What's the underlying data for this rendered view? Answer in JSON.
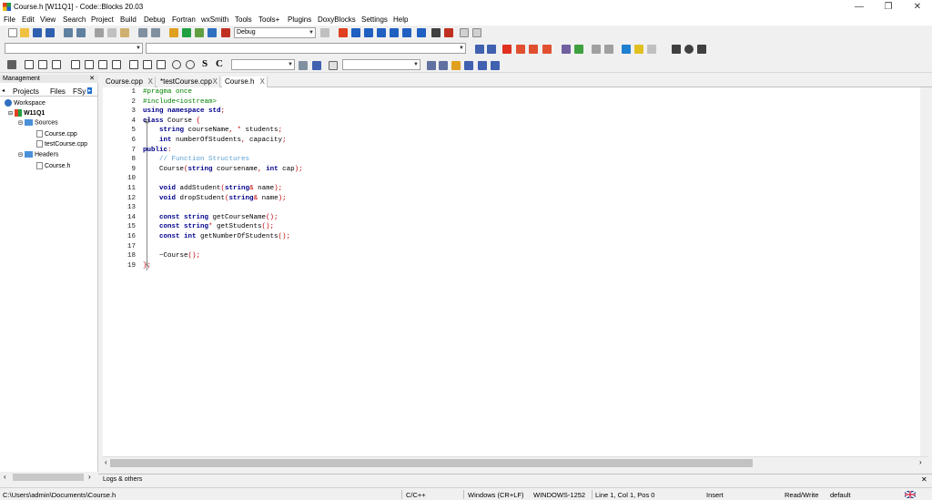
{
  "window": {
    "title": "Course.h [W11Q1] - Code::Blocks 20.03",
    "minimize_glyph": "—",
    "maximize_glyph": "❐",
    "close_glyph": "✕"
  },
  "menu": [
    "File",
    "Edit",
    "View",
    "Search",
    "Project",
    "Build",
    "Debug",
    "Fortran",
    "wxSmith",
    "Tools",
    "Tools+",
    "Plugins",
    "DoxyBlocks",
    "Settings",
    "Help"
  ],
  "toolbar": {
    "build_target": "Debug",
    "symbol_search": "S",
    "case_label": "C"
  },
  "management": {
    "header": "Management",
    "tabs": [
      "Projects",
      "Files",
      "FSy"
    ],
    "tree": {
      "workspace": "Workspace",
      "project": "W11Q1",
      "sources": "Sources",
      "source_files": [
        "Course.cpp",
        "testCourse.cpp"
      ],
      "headers": "Headers",
      "header_files": [
        "Course.h"
      ]
    }
  },
  "editor": {
    "tabs": [
      {
        "label": "Course.cpp",
        "active": false
      },
      {
        "label": "*testCourse.cpp",
        "active": false
      },
      {
        "label": "Course.h",
        "active": true
      }
    ],
    "tab_close_glyph": "X",
    "lines": [
      [
        {
          "t": "#pragma once",
          "c": "pp"
        }
      ],
      [
        {
          "t": "#include<iostream>",
          "c": "pp"
        }
      ],
      [
        {
          "t": "using namespace std",
          "c": "kw"
        },
        {
          "t": ";",
          "c": "op"
        }
      ],
      [
        {
          "t": "class",
          "c": "kw"
        },
        {
          "t": " Course ",
          "c": ""
        },
        {
          "t": "{",
          "c": "op"
        }
      ],
      [
        {
          "t": "    string",
          "c": "kw"
        },
        {
          "t": " courseName",
          "": ""
        },
        {
          "t": ", * ",
          "c": "op"
        },
        {
          "t": "students",
          "c": ""
        },
        {
          "t": ";",
          "c": "op"
        }
      ],
      [
        {
          "t": "    int",
          "c": "kw"
        },
        {
          "t": " numberOfStudents",
          "c": ""
        },
        {
          "t": ", ",
          "c": "op"
        },
        {
          "t": "capacity",
          "c": ""
        },
        {
          "t": ";",
          "c": "op"
        }
      ],
      [
        {
          "t": "public",
          "c": "kw"
        },
        {
          "t": ":",
          "c": "op"
        }
      ],
      [
        {
          "t": "    // Function Structures",
          "c": "cm"
        }
      ],
      [
        {
          "t": "    Course",
          "c": ""
        },
        {
          "t": "(",
          "c": "op"
        },
        {
          "t": "string",
          "c": "kw"
        },
        {
          "t": " coursename",
          "c": ""
        },
        {
          "t": ", ",
          "c": "op"
        },
        {
          "t": "int",
          "c": "kw"
        },
        {
          "t": " cap",
          "c": ""
        },
        {
          "t": ");",
          "c": "op"
        }
      ],
      [],
      [
        {
          "t": "    void",
          "c": "kw"
        },
        {
          "t": " addStudent",
          "c": ""
        },
        {
          "t": "(",
          "c": "op"
        },
        {
          "t": "string",
          "c": "kw"
        },
        {
          "t": "& ",
          "c": "op"
        },
        {
          "t": "name",
          "c": ""
        },
        {
          "t": ");",
          "c": "op"
        }
      ],
      [
        {
          "t": "    void",
          "c": "kw"
        },
        {
          "t": " dropStudent",
          "c": ""
        },
        {
          "t": "(",
          "c": "op"
        },
        {
          "t": "string",
          "c": "kw"
        },
        {
          "t": "& ",
          "c": "op"
        },
        {
          "t": "name",
          "c": ""
        },
        {
          "t": ");",
          "c": "op"
        }
      ],
      [],
      [
        {
          "t": "    const string",
          "c": "kw"
        },
        {
          "t": " getCourseName",
          "c": ""
        },
        {
          "t": "();",
          "c": "op"
        }
      ],
      [
        {
          "t": "    const string",
          "c": "kw"
        },
        {
          "t": "* ",
          "c": "op"
        },
        {
          "t": "getStudents",
          "c": ""
        },
        {
          "t": "();",
          "c": "op"
        }
      ],
      [
        {
          "t": "    const int",
          "c": "kw"
        },
        {
          "t": " getNumberOfStudents",
          "c": ""
        },
        {
          "t": "();",
          "c": "op"
        }
      ],
      [],
      [
        {
          "t": "    ~Course",
          "c": ""
        },
        {
          "t": "();",
          "c": "op"
        }
      ],
      [
        {
          "t": "};",
          "c": "op"
        }
      ]
    ]
  },
  "logs": {
    "label": "Logs & others",
    "close_glyph": "✕"
  },
  "status": {
    "path": "C:\\Users\\admin\\Documents\\Course.h",
    "language": "C/C++",
    "line_endings": "Windows (CR+LF)",
    "encoding": "WINDOWS-1252",
    "position": "Line 1, Col 1, Pos 0",
    "mode": "Insert",
    "access": "Read/Write",
    "profile": "default"
  },
  "colors": {
    "keyword": "#00008b",
    "preprocessor": "#008000",
    "comment": "#5a9fd4",
    "operator": "#c00000"
  }
}
